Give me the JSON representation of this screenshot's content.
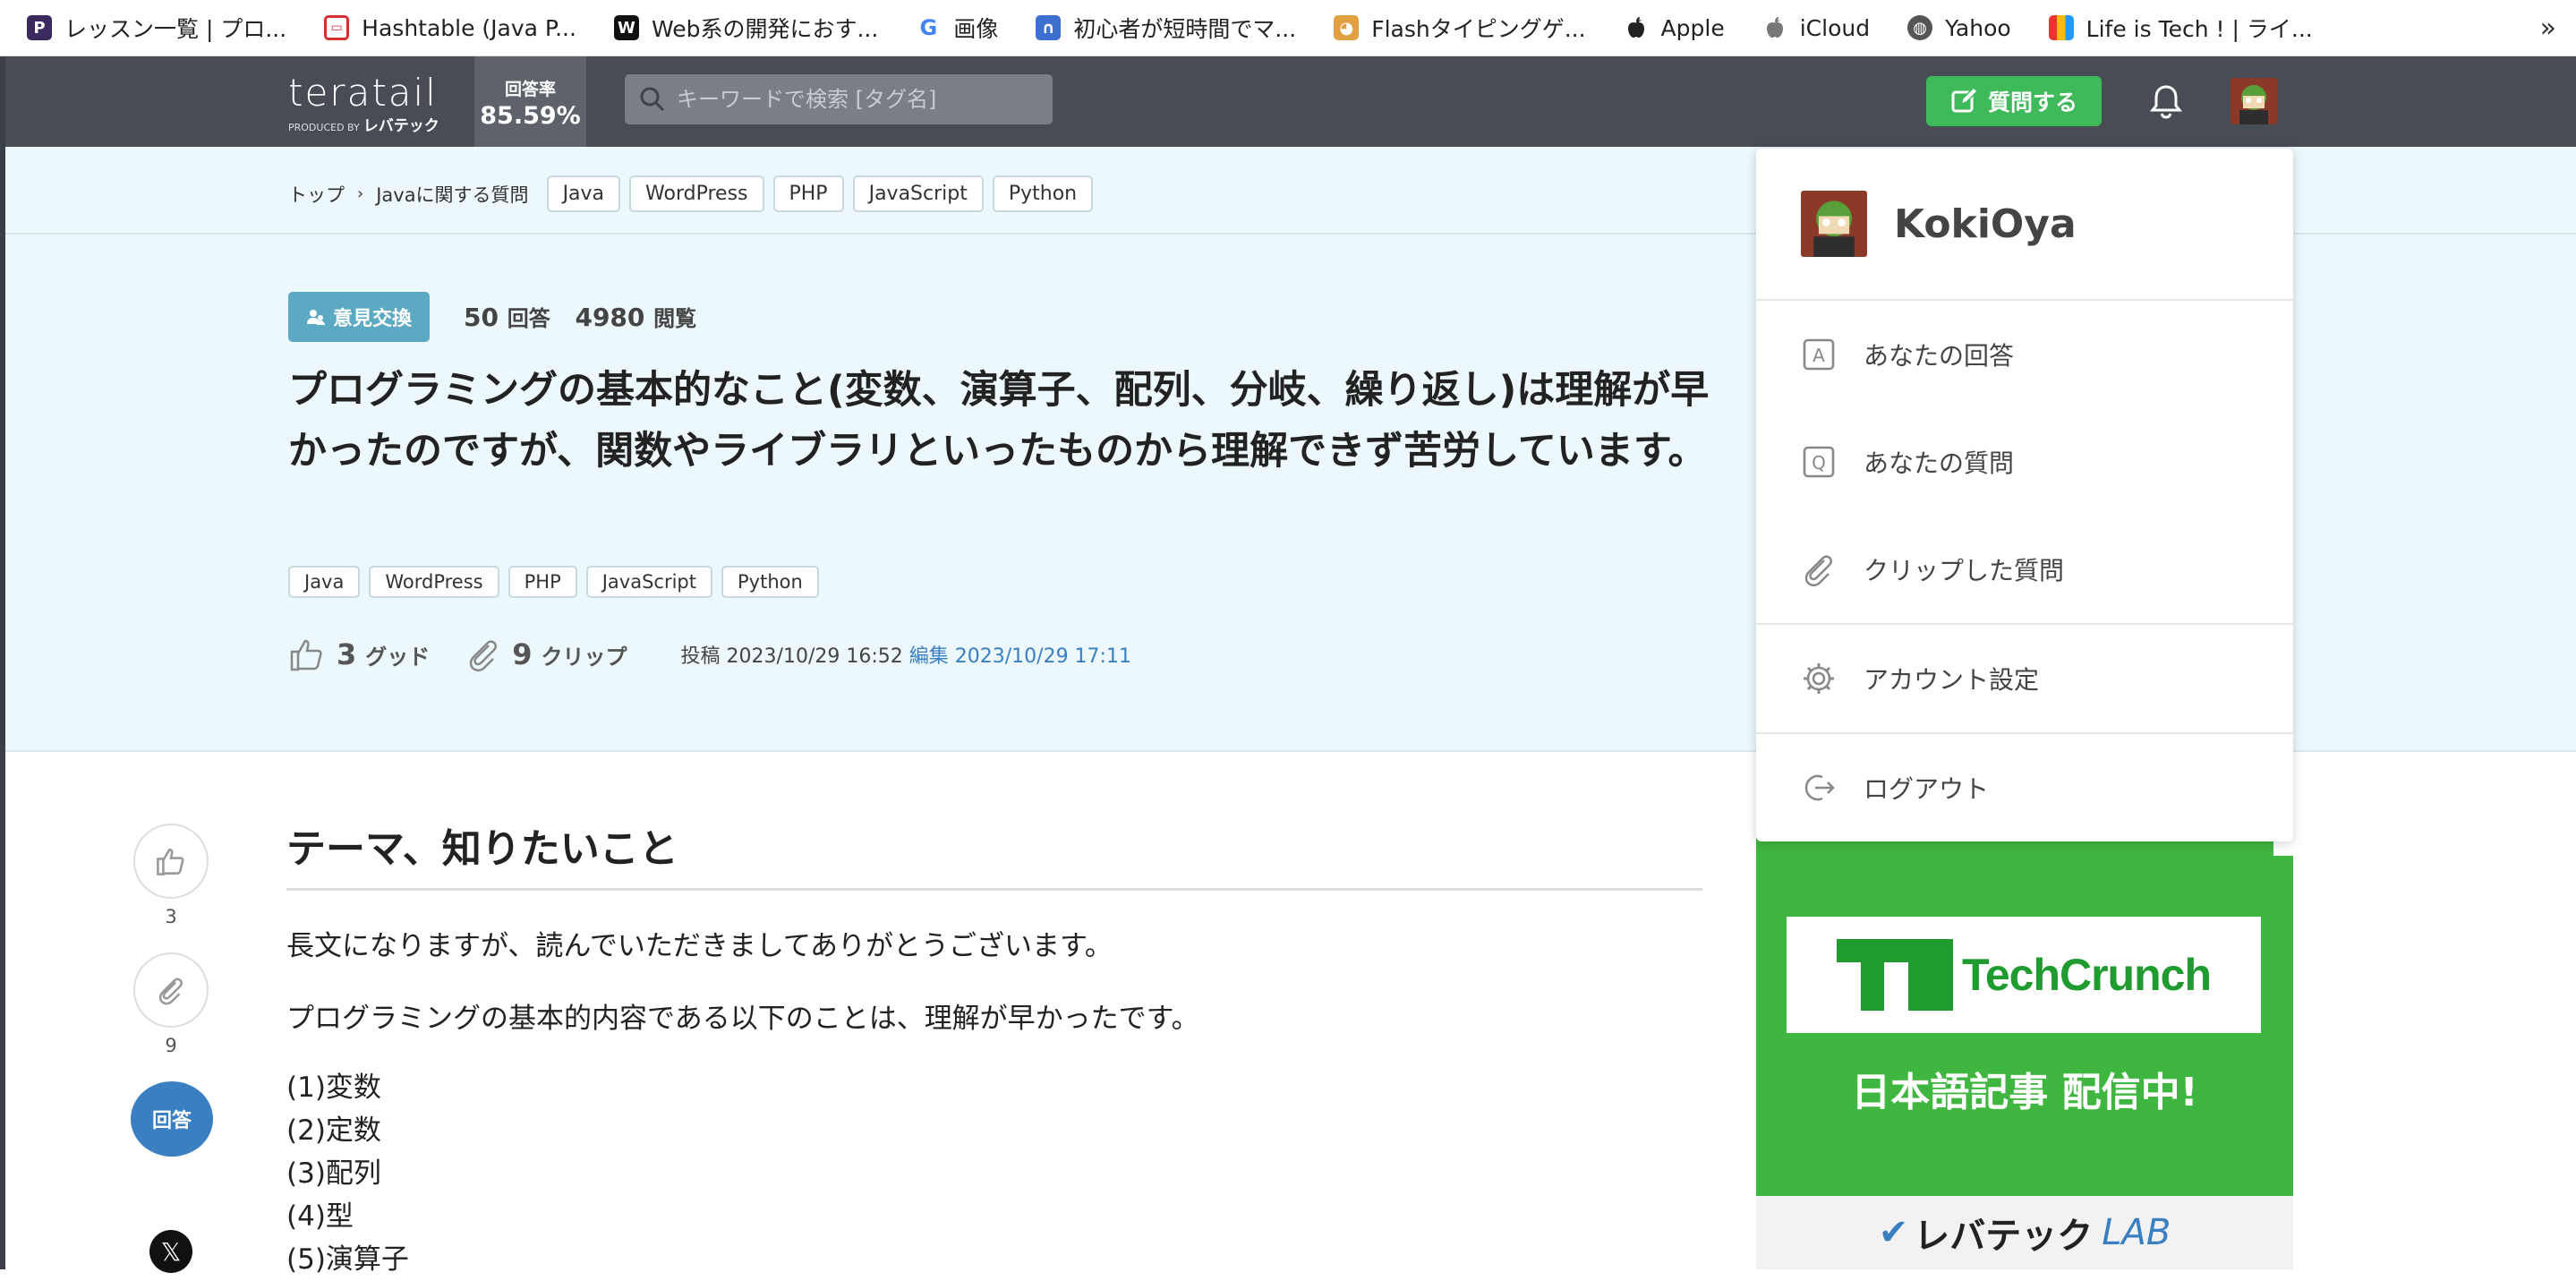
{
  "bookmarks": [
    {
      "label": "レッスン一覧 | プロ...",
      "color": "#3b2a5f",
      "glyph": "P"
    },
    {
      "label": "Hashtable (Java P...",
      "color": "#d92c2c",
      "glyph": "▭"
    },
    {
      "label": "Web系の開発におす...",
      "color": "#111111",
      "glyph": "W"
    },
    {
      "label": "画像",
      "color": "#ffffff",
      "glyph": "G"
    },
    {
      "label": "初心者が短時間でマ...",
      "color": "#3d6fd1",
      "glyph": "∩"
    },
    {
      "label": "Flashタイピングゲ...",
      "color": "#c97a1a",
      "glyph": "🐯"
    },
    {
      "label": "Apple",
      "color": "#ffffff",
      "glyph": ""
    },
    {
      "label": "iCloud",
      "color": "#ffffff",
      "glyph": ""
    },
    {
      "label": "Yahoo",
      "color": "#555555",
      "glyph": "◍"
    },
    {
      "label": "Life is Tech ! | ライ...",
      "color": "#e0b020",
      "glyph": "▮"
    }
  ],
  "header": {
    "logo": "teratail",
    "logo_sub": "PRODUCED BY",
    "logo_brand": "レバテック",
    "rate_label": "回答率",
    "rate_value": "85.59%",
    "search_placeholder": "キーワードで検索 [タグ名]",
    "ask_label": "質問する"
  },
  "breadcrumb": {
    "top": "トップ",
    "category": "Javaに関する質問",
    "tags": [
      "Java",
      "WordPress",
      "PHP",
      "JavaScript",
      "Python"
    ]
  },
  "question": {
    "badge": "意見交換",
    "answers_count": "50",
    "answers_unit": "回答",
    "views_count": "4980",
    "views_unit": "閲覧",
    "title": "プログラミングの基本的なこと(変数、演算子、配列、分岐、繰り返し)は理解が早かったのですが、関数やライブラリといったものから理解できず苦労しています。",
    "tags": [
      "Java",
      "WordPress",
      "PHP",
      "JavaScript",
      "Python"
    ],
    "good_count": "3",
    "good_label": "グッド",
    "clip_count": "9",
    "clip_label": "クリップ",
    "posted_label": "投稿",
    "posted_at": "2023/10/29 16:52",
    "edited_label": "編集",
    "edited_at": "2023/10/29 17:11"
  },
  "actions": {
    "good_count": "3",
    "clip_count": "9",
    "answer_label": "回答",
    "x_label": "𝕏"
  },
  "body": {
    "heading": "テーマ、知りたいこと",
    "p1": "長文になりますが、読んでいただきましてありがとうございます。",
    "p2": "プログラミングの基本的内容である以下のことは、理解が早かったです。",
    "list": [
      "(1)変数",
      "(2)定数",
      "(3)配列",
      "(4)型",
      "(5)演算子"
    ]
  },
  "menu": {
    "username": "KokiOya",
    "items": [
      {
        "label": "あなたの回答",
        "icon": "answer-icon"
      },
      {
        "label": "あなたの質問",
        "icon": "question-icon"
      },
      {
        "label": "クリップした質問",
        "icon": "clip-icon"
      },
      {
        "label": "アカウント設定",
        "icon": "gear-icon"
      },
      {
        "label": "ログアウト",
        "icon": "logout-icon"
      }
    ]
  },
  "ad": {
    "brand": "TechCrunch",
    "headline": "日本語記事 配信中!",
    "footer_brand": "レバテック",
    "footer_lab": "LAB"
  },
  "colors": {
    "header_bg": "#474c55",
    "question_bg": "#ecf8fc",
    "ask_button": "#3fba5a",
    "badge": "#5ba9c2",
    "answer_button": "#3a7fc2",
    "ad_bg": "#3fb63f"
  }
}
